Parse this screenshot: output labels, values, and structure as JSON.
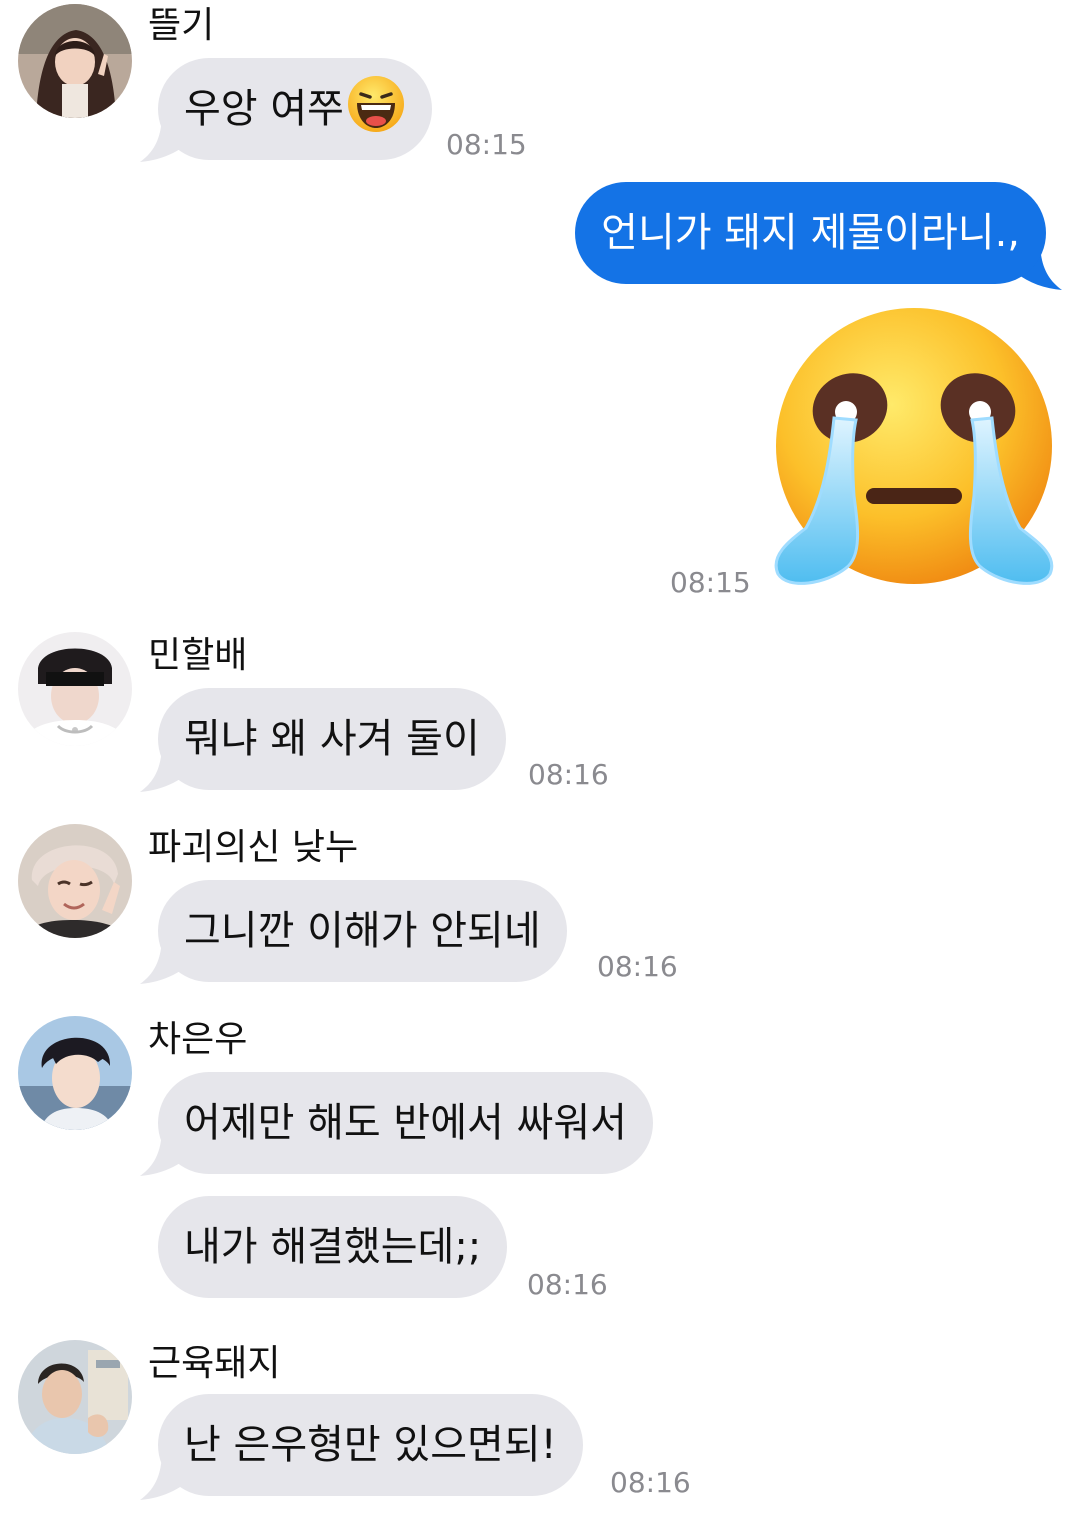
{
  "chat": {
    "messages": [
      {
        "sender": "뜰기",
        "avatar_icon": "avatar-ddeulgi-icon",
        "bubbles": [
          {
            "text": "우앙 여쭈",
            "emoji": "grinning-squint-emoji-icon"
          }
        ],
        "time": "08:15"
      },
      {
        "outgoing": true,
        "bubbles": [
          {
            "text": "언니가 돼지 제물이라니.,"
          }
        ]
      },
      {
        "outgoing": true,
        "sticker": "loudly-crying-face-sticker-icon",
        "time": "08:15"
      },
      {
        "sender": "민할배",
        "avatar_icon": "avatar-minhalbae-icon",
        "bubbles": [
          {
            "text": "뭐냐 왜 사겨 둘이"
          }
        ],
        "time": "08:16"
      },
      {
        "sender": "파괴의신 낮누",
        "avatar_icon": "avatar-pagoeuisin-icon",
        "bubbles": [
          {
            "text": "그니깐 이해가 안되네"
          }
        ],
        "time": "08:16"
      },
      {
        "sender": "차은우",
        "avatar_icon": "avatar-chaeunwoo-icon",
        "bubbles": [
          {
            "text": "어제만 해도 반에서 싸워서"
          },
          {
            "text": "내가 해결했는데;;"
          }
        ],
        "time": "08:16"
      },
      {
        "sender": "근육돼지",
        "avatar_icon": "avatar-geunyukdwaeji-icon",
        "bubbles": [
          {
            "text": "난 은우형만 있으면되!"
          }
        ],
        "time": "08:16"
      }
    ]
  },
  "colors": {
    "incoming_bubble": "#e6e6eb",
    "outgoing_bubble": "#1473e6",
    "timestamp": "#8a8a8f",
    "text": "#111111"
  }
}
